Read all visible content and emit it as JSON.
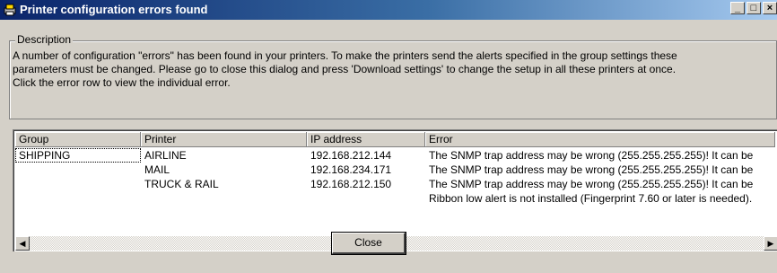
{
  "window": {
    "title": "Printer configuration errors found",
    "minimize": "_",
    "maximize": "□",
    "close": "×"
  },
  "description": {
    "legend": "Description",
    "lines": [
      "A number of configuration \"errors\" has been found in your printers. To make the printers send the alerts specified in the group settings these",
      "parameters must be changed. Please go to close this dialog and press 'Download settings' to change the setup in all these printers at once.",
      "Click the error row to view the individual error."
    ]
  },
  "table": {
    "columns": [
      "Group",
      "Printer",
      "IP address",
      "Error"
    ],
    "rows": [
      [
        "SHIPPING",
        "AIRLINE",
        "192.168.212.144",
        "The SNMP trap address may be wrong (255.255.255.255)! It can be"
      ],
      [
        "",
        "MAIL",
        "192.168.234.171",
        "The SNMP trap address may be wrong (255.255.255.255)! It can be"
      ],
      [
        "",
        "TRUCK & RAIL",
        "192.168.212.150",
        "The SNMP trap address may be wrong (255.255.255.255)! It can be"
      ],
      [
        "",
        "",
        "",
        "Ribbon low alert is not installed (Fingerprint 7.60 or later is needed)."
      ]
    ]
  },
  "scrollbar": {
    "left_arrow": "◀",
    "right_arrow": "▶"
  },
  "buttons": {
    "close": "Close"
  }
}
